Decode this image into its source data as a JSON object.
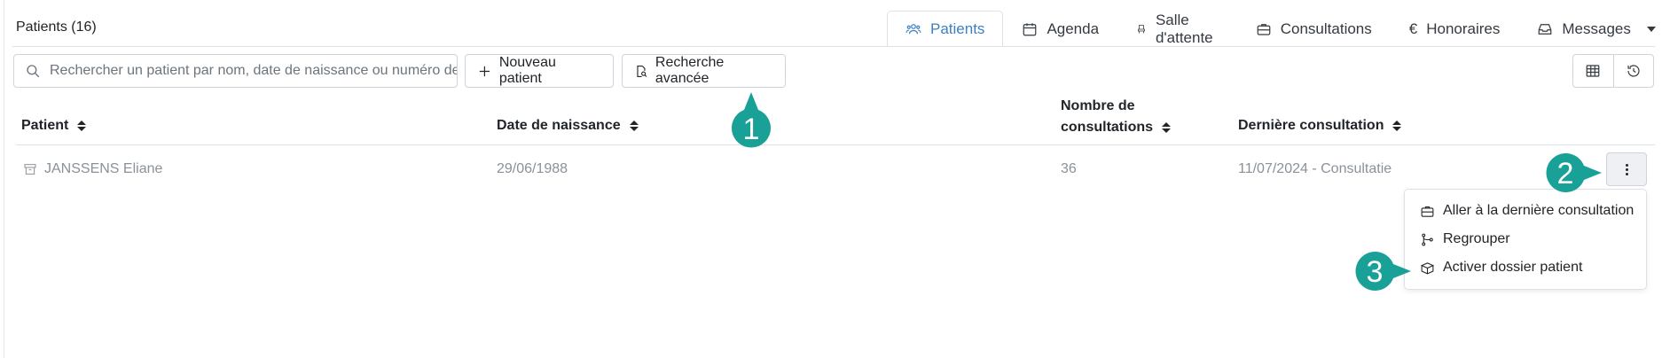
{
  "header": {
    "title": "Patients (16)"
  },
  "tabs": [
    {
      "label": "Patients",
      "icon": "users-icon",
      "active": true
    },
    {
      "label": "Agenda",
      "icon": "calendar-icon"
    },
    {
      "label": "Salle d'attente",
      "icon": "chair-icon"
    },
    {
      "label": "Consultations",
      "icon": "briefcase-icon"
    },
    {
      "label": "Honoraires",
      "icon": "euro-icon"
    },
    {
      "label": "Messages",
      "icon": "inbox-icon",
      "dropdown": true
    }
  ],
  "toolbar": {
    "search_placeholder": "Rechercher un patient par nom, date de naissance ou numéro de",
    "new_patient_label": "Nouveau patient",
    "advanced_search_label": "Recherche avancée"
  },
  "table": {
    "columns": [
      "Patient",
      "Date de naissance",
      "Nombre de consultations",
      "Dernière consultation"
    ],
    "columns_lines": {
      "consultations_line1": "Nombre de",
      "consultations_line2": "consultations"
    },
    "rows": [
      {
        "patient": "JANSSENS Eliane",
        "birth_date": "29/06/1988",
        "consultations": "36",
        "last_consultation": "11/07/2024 - Consultatie",
        "archived": true
      }
    ]
  },
  "row_menu": {
    "items": [
      {
        "label": "Aller à la dernière consultation",
        "icon": "briefcase-icon"
      },
      {
        "label": "Regrouper",
        "icon": "merge-icon"
      },
      {
        "label": "Activer dossier patient",
        "icon": "box-open-icon"
      }
    ]
  },
  "callouts": [
    "1",
    "2",
    "3"
  ],
  "colors": {
    "accent": "#3d7fc1",
    "callout": "#1aa197"
  }
}
